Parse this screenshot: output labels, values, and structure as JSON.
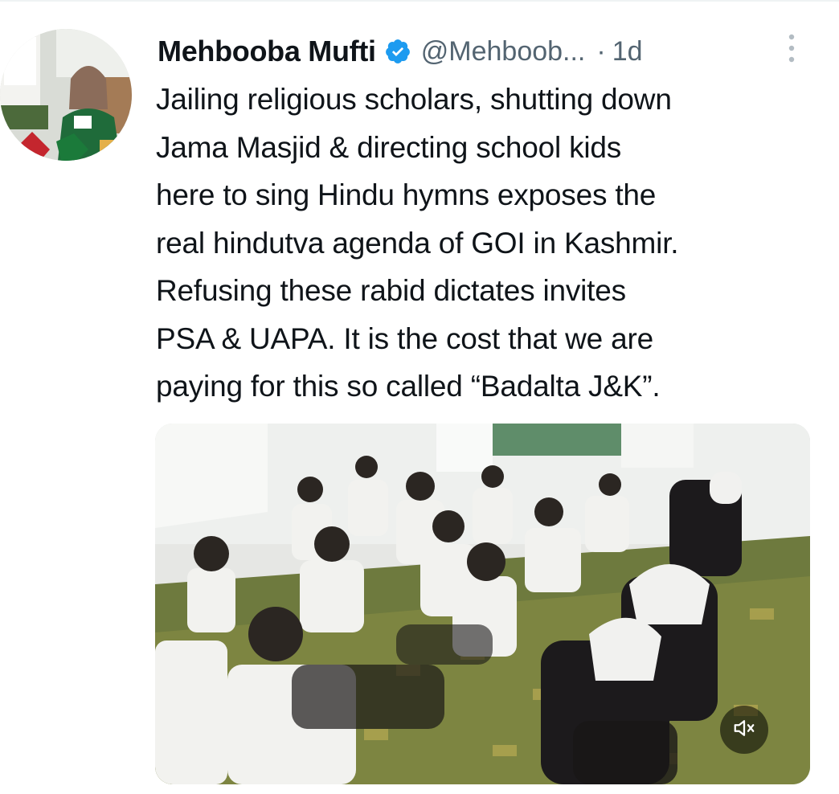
{
  "tweet": {
    "author": {
      "display_name": "Mehbooba Mufti",
      "handle": "@Mehboob...",
      "verified": true
    },
    "separator": "·",
    "time": "1d",
    "text": "Jailing religious scholars, shutting down\nJama Masjid  & directing school kids\nhere to sing Hindu hymns exposes the\nreal hindutva agenda of GOI in Kashmir.\nRefusing these rabid dictates invites\nPSA & UAPA. It is the cost that we are\npaying for this so called  “Badalta J&K”.",
    "media": {
      "type": "video",
      "muted": true
    }
  },
  "icons": {
    "verified": "verified-badge-icon",
    "more": "more-vertical-icon",
    "mute": "speaker-muted-icon"
  },
  "colors": {
    "verified_blue": "#1d9bf0",
    "secondary_text": "#536471",
    "primary_text": "#0f1419"
  }
}
